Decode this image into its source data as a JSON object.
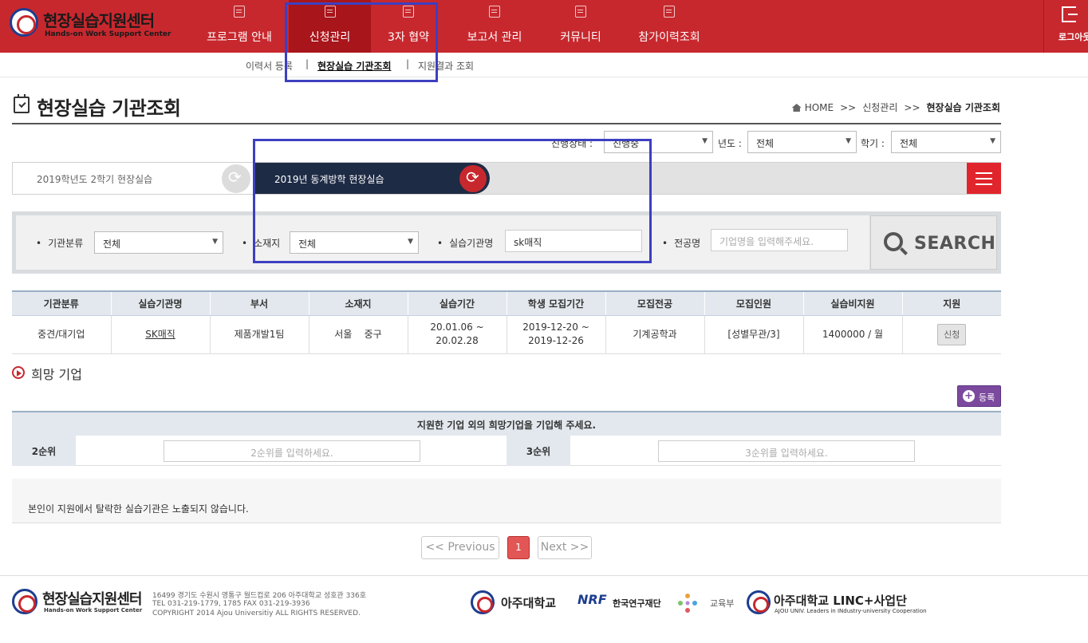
{
  "header": {
    "logo_title": "현장실습지원센터",
    "logo_subtitle": "Hands-on Work Support Center",
    "nav": [
      {
        "label": "프로그램 안내",
        "icon": "document-icon"
      },
      {
        "label": "신청관리",
        "icon": "search-doc-icon",
        "active": true
      },
      {
        "label": "3자 협약",
        "icon": "document-icon"
      },
      {
        "label": "보고서 관리",
        "icon": "folder-icon"
      },
      {
        "label": "커뮤니티",
        "icon": "podcast-icon"
      },
      {
        "label": "참가이력조회",
        "icon": "search-doc-icon"
      }
    ],
    "logout_label": "로그아웃"
  },
  "subnav": {
    "items": [
      {
        "label": "이력서 등록"
      },
      {
        "label": "현장실습 기관조회",
        "active": true
      },
      {
        "label": "지원결과 조회"
      }
    ],
    "separator": "|"
  },
  "page": {
    "title": "현장실습 기관조회",
    "breadcrumb": [
      "HOME",
      "신청관리",
      "현장실습 기관조회"
    ],
    "breadcrumb_sep": ">>"
  },
  "filters": {
    "status_label": "진행상태 :",
    "status_value": "진행중",
    "year_label": "년도 :",
    "year_value": "전체",
    "semester_label": "학기 :",
    "semester_value": "전체"
  },
  "semesters": {
    "previous": "2019학년도 2학기 현장실습",
    "current": "2019년 동계방학 현장실습"
  },
  "search": {
    "category_label": "기관분류",
    "category_value": "전체",
    "location_label": "소재지",
    "location_value": "전체",
    "org_label": "실습기관명",
    "org_value": "sk매직",
    "major_label": "전공명",
    "major_placeholder": "기업명을 입력해주세요.",
    "button_label": "SEARCH"
  },
  "table": {
    "headers": [
      "기관분류",
      "실습기관명",
      "부서",
      "소재지",
      "실습기간",
      "학생 모집기간",
      "모집전공",
      "모집인원",
      "실습비지원",
      "지원"
    ],
    "rows": [
      {
        "category": "중견/대기업",
        "org": "SK매직",
        "dept": "제품개발1팀",
        "location": "서울    중구",
        "period": "20.01.06 ~ 20.02.28",
        "recruit_start": "2019-12-20 ~",
        "recruit_end": "2019-12-26",
        "major": "기계공학과",
        "headcount": "[성별무관/3]",
        "pay": "1400000 / 월",
        "apply_label": "신청"
      }
    ]
  },
  "wish": {
    "title": "희망 기업",
    "register_label": "등록",
    "instruction": "지원한 기업 외의 희망기업을 기입해 주세요.",
    "rank2_label": "2순위",
    "rank2_placeholder": "2순위를 입력하세요.",
    "rank3_label": "3순위",
    "rank3_placeholder": "3순위를 입력하세요."
  },
  "notice": "본인이 지원에서 탈락한 실습기관은 노출되지 않습니다.",
  "pagination": {
    "prev_label": "<< Previous",
    "current_page": "1",
    "next_label": "Next >>"
  },
  "footer": {
    "logo_title": "현장실습지원센터",
    "logo_subtitle": "Hands-on Work Support Center",
    "address": "16499 경기도 수원시 영통구 월드컵로 206 아주대학교 성호관 336호",
    "tel": "TEL 031-219-1779, 1785 FAX 031-219-3936",
    "copyright": "COPYRIGHT 2014 Ajou Universitiy ALL RIGHTS RESERVED.",
    "partners": {
      "ajou": "아주대학교",
      "nrf_mark": "NRF",
      "nrf": "한국연구재단",
      "moe": "교육부",
      "linc": "아주대학교 LINC+사업단",
      "linc_sub": "AJOU UNIV. Leaders in INdustry-university Cooperation"
    }
  },
  "colors": {
    "brand_red": "#c7282e",
    "active_red": "#a8151b",
    "navy": "#1e2b45",
    "purple": "#7b4a9e",
    "annotation_blue": "#3d3fc1"
  }
}
